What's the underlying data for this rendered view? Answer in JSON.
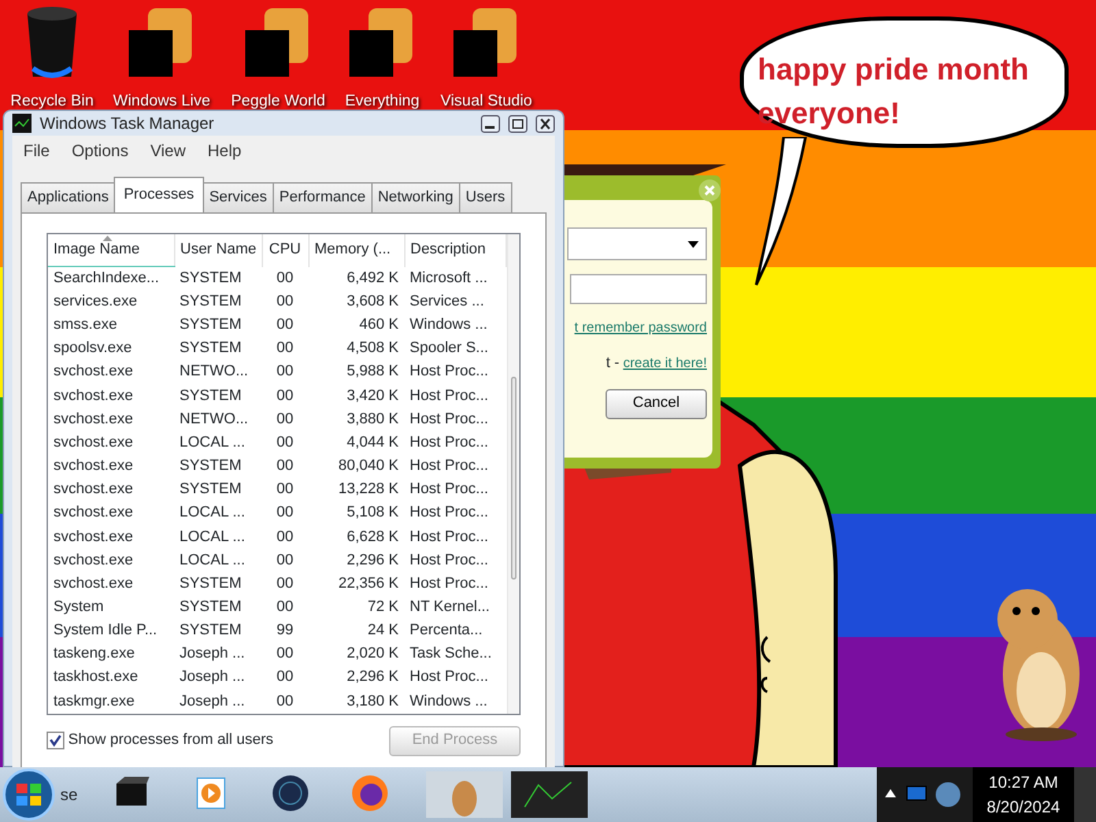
{
  "desktop_icons": [
    {
      "kind": "bin",
      "label": "Recycle Bin"
    },
    {
      "kind": "censored",
      "label": "Windows Live"
    },
    {
      "kind": "censored",
      "label": "Peggle World"
    },
    {
      "kind": "censored",
      "label": "Everything"
    },
    {
      "kind": "censored",
      "label": "Visual Studio"
    }
  ],
  "speech_bubble": {
    "text": "happy pride month everyone!"
  },
  "login_dialog": {
    "remember_link": "t remember password",
    "create_prefix": "t -",
    "create_link": "create it here!",
    "cancel_button": "Cancel"
  },
  "task_manager": {
    "title": "Windows Task Manager",
    "menu": [
      "File",
      "Options",
      "View",
      "Help"
    ],
    "tabs": [
      {
        "label": "Applications",
        "selected": false
      },
      {
        "label": "Processes",
        "selected": true
      },
      {
        "label": "Services",
        "selected": false
      },
      {
        "label": "Performance",
        "selected": false
      },
      {
        "label": "Networking",
        "selected": false
      },
      {
        "label": "Users",
        "selected": false
      }
    ],
    "columns": [
      "Image Name",
      "User Name",
      "CPU",
      "Memory (...",
      "Description"
    ],
    "rows": [
      [
        "SearchIndexe...",
        "SYSTEM",
        "00",
        "6,492 K",
        "Microsoft ..."
      ],
      [
        "services.exe",
        "SYSTEM",
        "00",
        "3,608 K",
        "Services ..."
      ],
      [
        "smss.exe",
        "SYSTEM",
        "00",
        "460 K",
        "Windows ..."
      ],
      [
        "spoolsv.exe",
        "SYSTEM",
        "00",
        "4,508 K",
        "Spooler S..."
      ],
      [
        "svchost.exe",
        "NETWO...",
        "00",
        "5,988 K",
        "Host Proc..."
      ],
      [
        "svchost.exe",
        "SYSTEM",
        "00",
        "3,420 K",
        "Host Proc..."
      ],
      [
        "svchost.exe",
        "NETWO...",
        "00",
        "3,880 K",
        "Host Proc..."
      ],
      [
        "svchost.exe",
        "LOCAL ...",
        "00",
        "4,044 K",
        "Host Proc..."
      ],
      [
        "svchost.exe",
        "SYSTEM",
        "00",
        "80,040 K",
        "Host Proc..."
      ],
      [
        "svchost.exe",
        "SYSTEM",
        "00",
        "13,228 K",
        "Host Proc..."
      ],
      [
        "svchost.exe",
        "LOCAL ...",
        "00",
        "5,108 K",
        "Host Proc..."
      ],
      [
        "svchost.exe",
        "LOCAL ...",
        "00",
        "6,628 K",
        "Host Proc..."
      ],
      [
        "svchost.exe",
        "LOCAL ...",
        "00",
        "2,296 K",
        "Host Proc..."
      ],
      [
        "svchost.exe",
        "SYSTEM",
        "00",
        "22,356 K",
        "Host Proc..."
      ],
      [
        "System",
        "SYSTEM",
        "00",
        "72 K",
        "NT Kernel..."
      ],
      [
        "System Idle P...",
        "SYSTEM",
        "99",
        "24 K",
        "Percenta..."
      ],
      [
        "taskeng.exe",
        "Joseph ...",
        "00",
        "2,020 K",
        "Task Sche..."
      ],
      [
        "taskhost.exe",
        "Joseph ...",
        "00",
        "2,296 K",
        "Host Proc..."
      ],
      [
        "taskmgr.exe",
        "Joseph ...",
        "00",
        "3,180 K",
        "Windows ..."
      ]
    ],
    "show_all_users": {
      "label": "Show processes from all users",
      "checked": true
    },
    "end_process": {
      "label": "End Process",
      "disabled": true
    }
  },
  "taskbar": {
    "search_text": "se",
    "apps": [
      {
        "kind": "box"
      },
      {
        "kind": "media"
      },
      {
        "kind": "globe"
      },
      {
        "kind": "firefox"
      },
      {
        "kind": "thumb-hamster"
      },
      {
        "kind": "thumb-monitor"
      }
    ],
    "clock": {
      "time": "10:27 AM",
      "date": "8/20/2024"
    }
  }
}
